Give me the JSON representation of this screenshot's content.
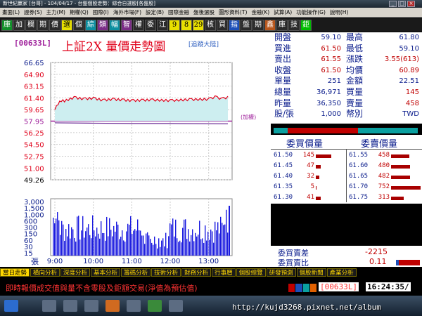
{
  "window": {
    "title": "新世紀贏家 [台哥] - 104/04/17 - 台盤個股走勢：綜合自選股[各盤股]"
  },
  "menu": [
    "畫面(L)",
    "證券(S)",
    "主力(M)",
    "期權(Q)",
    "國際(I)",
    "海外市場(F)",
    "設定(B)",
    "國際金融",
    "盤後選股",
    "圖形資料(T)",
    "金融(K)",
    "試算(A)",
    "功能操作(G)",
    "說明(H)"
  ],
  "toolbar": {
    "buttons": [
      "庫",
      "加",
      "欄",
      "期",
      "價",
      "選",
      "個",
      "綜",
      "類",
      "幅",
      "智",
      "權",
      "委",
      "江",
      "9",
      "8",
      "29",
      "核",
      "買",
      "指",
      "盤",
      "期",
      "鑫",
      "庫",
      "技",
      "鉅"
    ],
    "colors": [
      "g",
      "",
      "",
      "",
      "",
      "y",
      "",
      "c",
      "m",
      "c",
      "m",
      "",
      "",
      "",
      "y",
      "y",
      "y",
      "",
      "",
      "b",
      "",
      "",
      "o",
      "",
      "",
      "sq"
    ]
  },
  "chart_header": {
    "code": "[00633L]",
    "title": "上証2X  量價走勢圖",
    "follow": "[追蹤大陸]"
  },
  "chart_data": {
    "type": "line",
    "title": "上証2X  量價走勢圖",
    "x_ticks": [
      "9:00",
      "10:00",
      "11:00",
      "12:00",
      "13:00"
    ],
    "price_ticks": [
      "66.65",
      "64.90",
      "63.15",
      "61.40",
      "59.65",
      "57.95",
      "56.25",
      "54.50",
      "52.75",
      "51.00",
      "49.26"
    ],
    "price_ylim": [
      49.26,
      66.65
    ],
    "prev_close": 57.95,
    "volume_ticks": [
      "3,000",
      "1,500",
      "1,000",
      "600",
      "300",
      "150",
      "60",
      "30",
      "15"
    ],
    "volume_unit": "張",
    "weighted_label": "(加權)",
    "price_series": [
      {
        "x": "9:00",
        "y": 59.65
      },
      {
        "x": "9:05",
        "y": 60.55
      },
      {
        "x": "9:10",
        "y": 61.0
      },
      {
        "x": "9:15",
        "y": 60.95
      },
      {
        "x": "9:30",
        "y": 61.45
      },
      {
        "x": "9:45",
        "y": 61.25
      },
      {
        "x": "10:00",
        "y": 61.35
      },
      {
        "x": "10:15",
        "y": 61.05
      },
      {
        "x": "10:30",
        "y": 61.2
      },
      {
        "x": "10:45",
        "y": 61.1
      },
      {
        "x": "11:00",
        "y": 61.0
      },
      {
        "x": "11:15",
        "y": 61.05
      },
      {
        "x": "11:30",
        "y": 61.1
      },
      {
        "x": "12:00",
        "y": 61.0
      },
      {
        "x": "12:30",
        "y": 61.15
      },
      {
        "x": "13:00",
        "y": 61.2
      },
      {
        "x": "13:10",
        "y": 61.55
      },
      {
        "x": "13:20",
        "y": 61.25
      },
      {
        "x": "13:30",
        "y": 61.5
      }
    ],
    "weighted_series": [
      {
        "x": "9:00",
        "y": 57.7
      },
      {
        "x": "10:00",
        "y": 57.65
      },
      {
        "x": "11:00",
        "y": 57.6
      },
      {
        "x": "12:00",
        "y": 57.6
      },
      {
        "x": "13:30",
        "y": 57.55
      }
    ],
    "grid": true
  },
  "quote": {
    "rows": [
      {
        "l1": "開盤",
        "v1": "59.10",
        "l2": "最高",
        "v2": "61.80"
      },
      {
        "l1": "買進",
        "v1": "61.50",
        "l2": "最低",
        "v2": "59.10"
      },
      {
        "l1": "賣出",
        "v1": "61.55",
        "l2": "漲跌",
        "v2": "3.55(613)"
      },
      {
        "l1": "收盤",
        "v1": "61.50",
        "l2": "均價",
        "v2": "60.89"
      },
      {
        "l1": "單量",
        "v1": "251",
        "l2": "金額",
        "v2": "22.51"
      },
      {
        "l1": "總量",
        "v1": "36,971",
        "l2": "買量",
        "v2": "145"
      },
      {
        "l1": "昨量",
        "v1": "36,350",
        "l2": "賣量",
        "v2": "458"
      },
      {
        "l1": "股/張",
        "v1": "1,000",
        "l2": "幣別",
        "v2": "TWD"
      }
    ]
  },
  "orderbook": {
    "bid_header": "委買價量",
    "ask_header": "委賣價量",
    "bids": [
      {
        "price": "61.50",
        "qty": "145",
        "level": 0.5
      },
      {
        "price": "61.45",
        "qty": "47",
        "level": 0.17
      },
      {
        "price": "61.40",
        "qty": "32",
        "level": 0.12
      },
      {
        "price": "61.35",
        "qty": "5",
        "level": 0.03
      },
      {
        "price": "61.30",
        "qty": "41",
        "level": 0.15
      }
    ],
    "asks": [
      {
        "price": "61.55",
        "qty": "458",
        "level": 0.58
      },
      {
        "price": "61.60",
        "qty": "480",
        "level": 0.61
      },
      {
        "price": "61.65",
        "qty": "482",
        "level": 0.62
      },
      {
        "price": "61.70",
        "qty": "752",
        "level": 0.95
      },
      {
        "price": "61.75",
        "qty": "313",
        "level": 0.4
      }
    ],
    "diff_label": "委買賣差",
    "diff_value": "-2215",
    "ratio_label": "委買賣比",
    "ratio_value": "0.11"
  },
  "tabs": [
    "當日走勢",
    "橫向分析",
    "深度分析",
    "基本分析",
    "籌碼分析",
    "技術分析",
    "財務分析",
    "行事曆",
    "個股總覽",
    "研發預測",
    "個股新聞",
    "產業分析"
  ],
  "status": {
    "message": "即時報價成交值與量不含零股及鉅額交易(淨值為預估值)",
    "code": "[00633L]",
    "time": "16:24:35/"
  },
  "footer": {
    "url": "http://kujd3268.pixnet.net/album"
  }
}
